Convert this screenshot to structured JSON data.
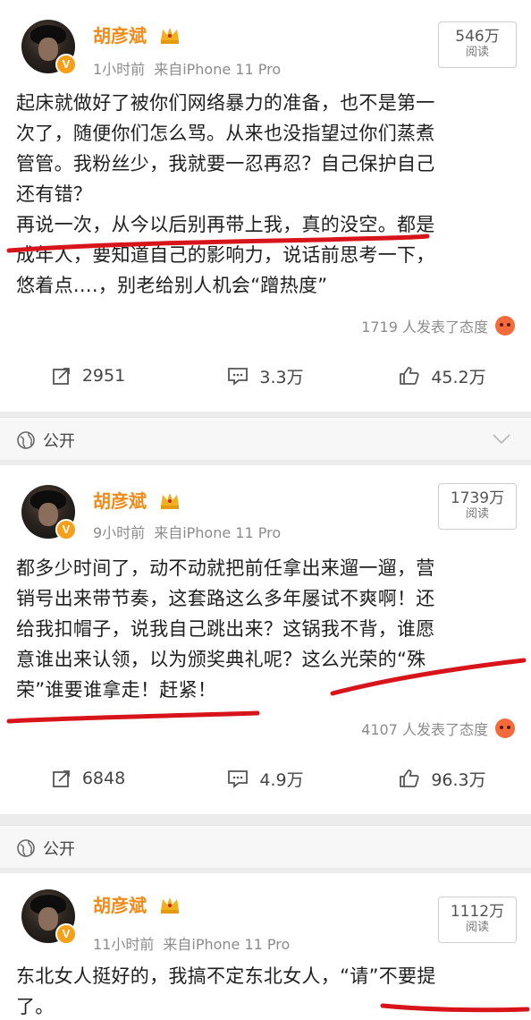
{
  "posts": [
    {
      "username": "胡彦斌",
      "time": "1小时前",
      "source": "来自iPhone 11 Pro",
      "views": "546万",
      "views_label": "阅读",
      "text": "起床就做好了被你们网络暴力的准备，也不是第一\n次了，随便你们怎么骂。从来也没指望过你们蒸煮\n管管。我粉丝少，我就要一忍再忍？自己保护自己\n还有错？\n再说一次，从今以后别再带上我，真的没空。都是\n成年人，要知道自己的影响力，说话前思考一下，\n悠着点....，别老给别人机会“蹭热度”",
      "reactions": "1719 人发表了态度",
      "reposts": "2951",
      "comments": "3.3万",
      "likes": "45.2万"
    },
    {
      "username": "胡彦斌",
      "time": "9小时前",
      "source": "来自iPhone 11 Pro",
      "views": "1739万",
      "views_label": "阅读",
      "text": "都多少时间了，动不动就把前任拿出来遛一遛，营\n销号出来带节奏，这套路这么多年屡试不爽啊！还\n给我扣帽子，说我自己跳出来？这锅我不背，谁愿\n意谁出来认领，以为颁奖典礼呢？这么光荣的“殊\n荣”谁要谁拿走！赶紧！",
      "reactions": "4107 人发表了态度",
      "reposts": "6848",
      "comments": "4.9万",
      "likes": "96.3万"
    },
    {
      "username": "胡彦斌",
      "time": "11小时前",
      "source": "来自iPhone 11 Pro",
      "views": "1112万",
      "views_label": "阅读",
      "text": "东北女人挺好的，我搞不定东北女人，“请”不要提\n了。"
    }
  ],
  "visibility": [
    "公开",
    "公开"
  ],
  "colors": {
    "username": "#f08a1a",
    "badge": "#f6a01a",
    "underline": "#d8141b"
  },
  "icons": [
    "repost-icon",
    "comment-icon",
    "like-icon",
    "globe-icon",
    "chevron-down-icon",
    "crown-icon",
    "angry-face-icon"
  ]
}
